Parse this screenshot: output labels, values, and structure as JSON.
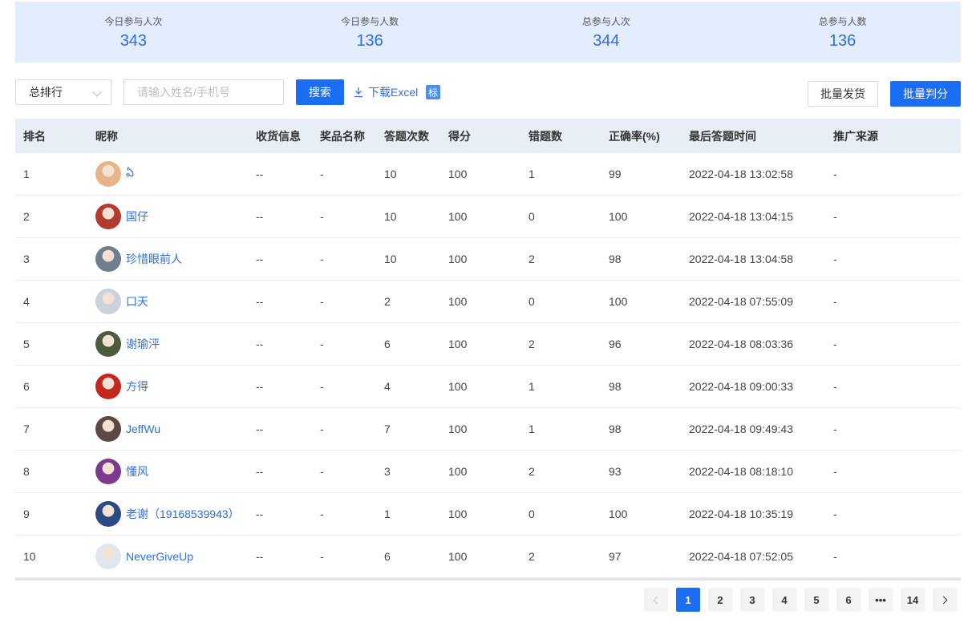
{
  "stats": [
    {
      "label": "今日参与人次",
      "value": "343"
    },
    {
      "label": "今日参与人数",
      "value": "136"
    },
    {
      "label": "总参与人次",
      "value": "344"
    },
    {
      "label": "总参与人数",
      "value": "136"
    }
  ],
  "toolbar": {
    "ranking_select": "总排行",
    "search_placeholder": "请输入姓名/手机号",
    "search_button": "搜索",
    "download_label": "下载Excel",
    "badge": "标",
    "batch_ship_button": "批量发货",
    "batch_judge_button": "批量判分"
  },
  "table": {
    "headers": [
      "排名",
      "昵称",
      "收货信息",
      "奖品名称",
      "答题次数",
      "得分",
      "错题数",
      "正确率(%)",
      "最后答题时间",
      "推广来源"
    ],
    "rows": [
      {
        "rank": "1",
        "nick": "ఏ",
        "ship": "--",
        "prize": "-",
        "times": "10",
        "score": "100",
        "wrong": "1",
        "acc": "99",
        "last": "2022-04-18 13:02:58",
        "src": "-",
        "avatar_color": "#e8b48a"
      },
      {
        "rank": "2",
        "nick": "国仔",
        "ship": "--",
        "prize": "-",
        "times": "10",
        "score": "100",
        "wrong": "0",
        "acc": "100",
        "last": "2022-04-18 13:04:15",
        "src": "-",
        "avatar_color": "#b23a2f"
      },
      {
        "rank": "3",
        "nick": "珍惜眼前人",
        "ship": "--",
        "prize": "-",
        "times": "10",
        "score": "100",
        "wrong": "2",
        "acc": "98",
        "last": "2022-04-18 13:04:58",
        "src": "-",
        "avatar_color": "#6f7d8c"
      },
      {
        "rank": "4",
        "nick": "口天",
        "ship": "--",
        "prize": "-",
        "times": "2",
        "score": "100",
        "wrong": "0",
        "acc": "100",
        "last": "2022-04-18 07:55:09",
        "src": "-",
        "avatar_color": "#c9d3dc"
      },
      {
        "rank": "5",
        "nick": "谢瑜泙",
        "ship": "--",
        "prize": "-",
        "times": "6",
        "score": "100",
        "wrong": "2",
        "acc": "96",
        "last": "2022-04-18 08:03:36",
        "src": "-",
        "avatar_color": "#4d5a3e"
      },
      {
        "rank": "6",
        "nick": "方得",
        "ship": "--",
        "prize": "-",
        "times": "4",
        "score": "100",
        "wrong": "1",
        "acc": "98",
        "last": "2022-04-18 09:00:33",
        "src": "-",
        "avatar_color": "#c4271d"
      },
      {
        "rank": "7",
        "nick": "JeffWu",
        "ship": "--",
        "prize": "-",
        "times": "7",
        "score": "100",
        "wrong": "1",
        "acc": "98",
        "last": "2022-04-18 09:49:43",
        "src": "-",
        "avatar_color": "#5a4a42"
      },
      {
        "rank": "8",
        "nick": "懂风",
        "ship": "--",
        "prize": "-",
        "times": "3",
        "score": "100",
        "wrong": "2",
        "acc": "93",
        "last": "2022-04-18 08:18:10",
        "src": "-",
        "avatar_color": "#7b3a8c"
      },
      {
        "rank": "9",
        "nick": "老谢（19168539943）",
        "ship": "--",
        "prize": "-",
        "times": "1",
        "score": "100",
        "wrong": "0",
        "acc": "100",
        "last": "2022-04-18 10:35:19",
        "src": "-",
        "avatar_color": "#2b4a86"
      },
      {
        "rank": "10",
        "nick": "NeverGiveUp",
        "ship": "--",
        "prize": "-",
        "times": "6",
        "score": "100",
        "wrong": "2",
        "acc": "97",
        "last": "2022-04-18 07:52:05",
        "src": "-",
        "avatar_color": "#dfe6ee"
      }
    ]
  },
  "pagination": {
    "pages": [
      "1",
      "2",
      "3",
      "4",
      "5",
      "6"
    ],
    "current": "1",
    "ellipsis": "•••",
    "last_page": "14"
  },
  "colors": {
    "accent": "#1b6ef3",
    "stats_bg": "#e3edfd",
    "link": "#2f6fe0"
  }
}
